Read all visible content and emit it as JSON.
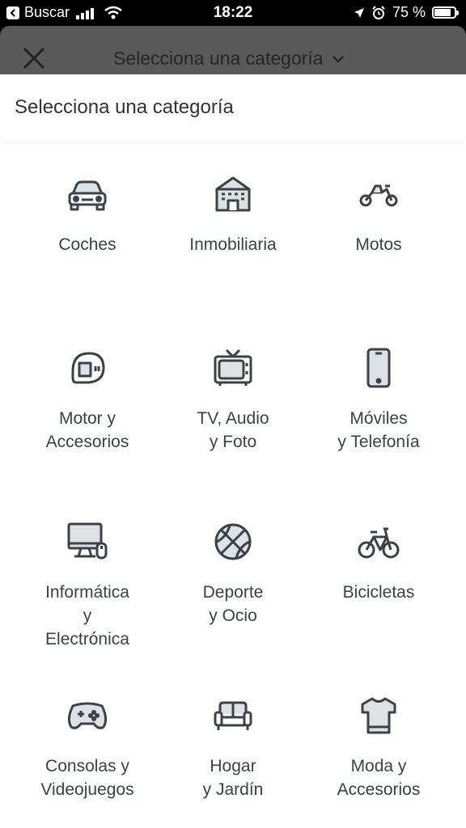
{
  "status_bar": {
    "back_app": "Buscar",
    "time": "18:22",
    "battery": "75 %"
  },
  "header": {
    "title": "Selecciona una categoría"
  },
  "sheet": {
    "title": "Selecciona una categoría"
  },
  "categories": [
    {
      "label": "Coches",
      "icon": "car-icon"
    },
    {
      "label": "Inmobiliaria",
      "icon": "house-icon"
    },
    {
      "label": "Motos",
      "icon": "motorcycle-icon"
    },
    {
      "label": "Motor y\nAccesorios",
      "icon": "helmet-icon"
    },
    {
      "label": "TV, Audio\ny Foto",
      "icon": "tv-icon"
    },
    {
      "label": "Móviles\ny Telefonía",
      "icon": "phone-icon"
    },
    {
      "label": "Informática\ny\nElectrónica",
      "icon": "computer-icon"
    },
    {
      "label": "Deporte\ny Ocio",
      "icon": "ball-icon"
    },
    {
      "label": "Bicicletas",
      "icon": "bicycle-icon"
    },
    {
      "label": "Consolas y\nVideojuegos",
      "icon": "gamepad-icon"
    },
    {
      "label": "Hogar\ny Jardín",
      "icon": "sofa-icon"
    },
    {
      "label": "Moda y\nAccesorios",
      "icon": "tshirt-icon"
    }
  ]
}
